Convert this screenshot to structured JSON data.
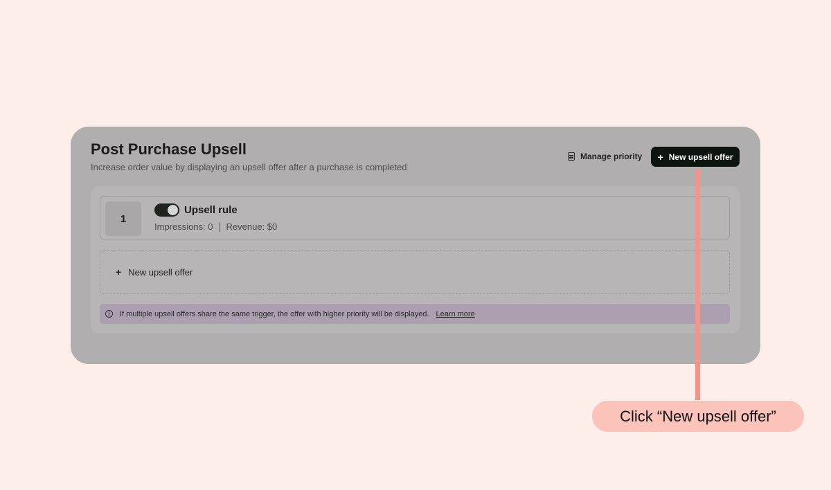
{
  "page": {
    "title": "Post Purchase Upsell",
    "subtitle": "Increase order value by displaying an upsell offer after a purchase is completed"
  },
  "header_actions": {
    "manage_priority_label": "Manage priority",
    "new_offer_label": "New upsell offer"
  },
  "rules": [
    {
      "rank": "1",
      "enabled": true,
      "name": "Upsell rule",
      "impressions": "Impressions: 0",
      "revenue": "Revenue: $0"
    }
  ],
  "add_row": {
    "label": "New upsell offer"
  },
  "info": {
    "text": "If multiple upsell offers share the same trigger, the offer with higher priority will be displayed.",
    "link": "Learn more"
  },
  "callout": {
    "text": "Click “New upsell offer”"
  },
  "colors": {
    "background": "#fdeeea",
    "primary_button": "#0e1511",
    "callout_accent": "#f4948a",
    "callout_bg": "#fcc3bb"
  },
  "icons": [
    "list-icon",
    "plus-icon",
    "toggle-switch",
    "info-icon"
  ]
}
